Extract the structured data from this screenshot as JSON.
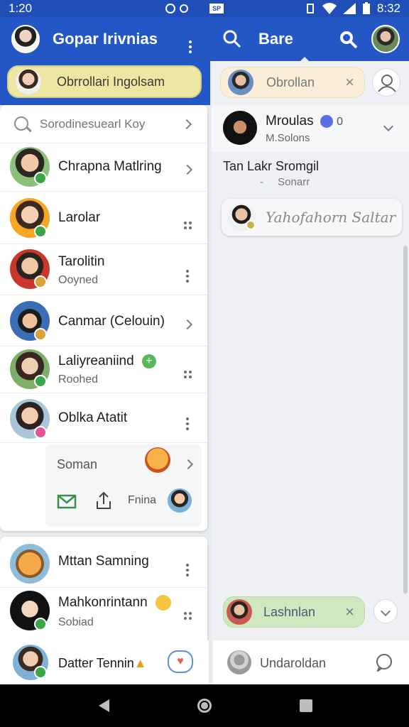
{
  "status": {
    "time_left": "1:20",
    "time_right": "8:32",
    "badge": "SP"
  },
  "appbar": {
    "title": "Gopar Irivnias",
    "title_right": "Bare"
  },
  "left": {
    "pill_label": "Obrrollari Ingolsam",
    "search_placeholder": "Sorodinesuearl Koy",
    "contacts": [
      {
        "name": "Chrapna Matlring",
        "sub": ""
      },
      {
        "name": "Larolar",
        "sub": ""
      },
      {
        "name": "Tarolitin",
        "sub": "Ooyned"
      },
      {
        "name": "Canmar (Celouin)",
        "sub": ""
      },
      {
        "name": "Laliyreaniind",
        "sub": "Roohed"
      },
      {
        "name": "Oblka Atatit",
        "sub": ""
      }
    ],
    "expanded": {
      "label": "Soman",
      "share_label": "Fnina"
    },
    "contacts2": [
      {
        "name": "Mttan Samning",
        "sub": ""
      },
      {
        "name": "Mahkonrintann",
        "sub": "Sobiad"
      }
    ],
    "bottom": {
      "name": "Datter Tennin"
    }
  },
  "right": {
    "pill_label": "Obrollan",
    "contact": {
      "name": "Mroulas",
      "count": "0",
      "sub": "M.Solons"
    },
    "message_title": "Tan Lakr Sromgil",
    "message_sub": "Sonarr",
    "suggestion": "Yahofahorn Saltar",
    "bottom_pill": "Lashnlan",
    "bottom_name": "Undaroldan"
  },
  "colors": {
    "primary": "#2357c6",
    "status": "#1f4fb6",
    "pill_yellow": "#ede7a3",
    "pill_green": "#cfe8c0",
    "badge_green": "#3aa648"
  }
}
